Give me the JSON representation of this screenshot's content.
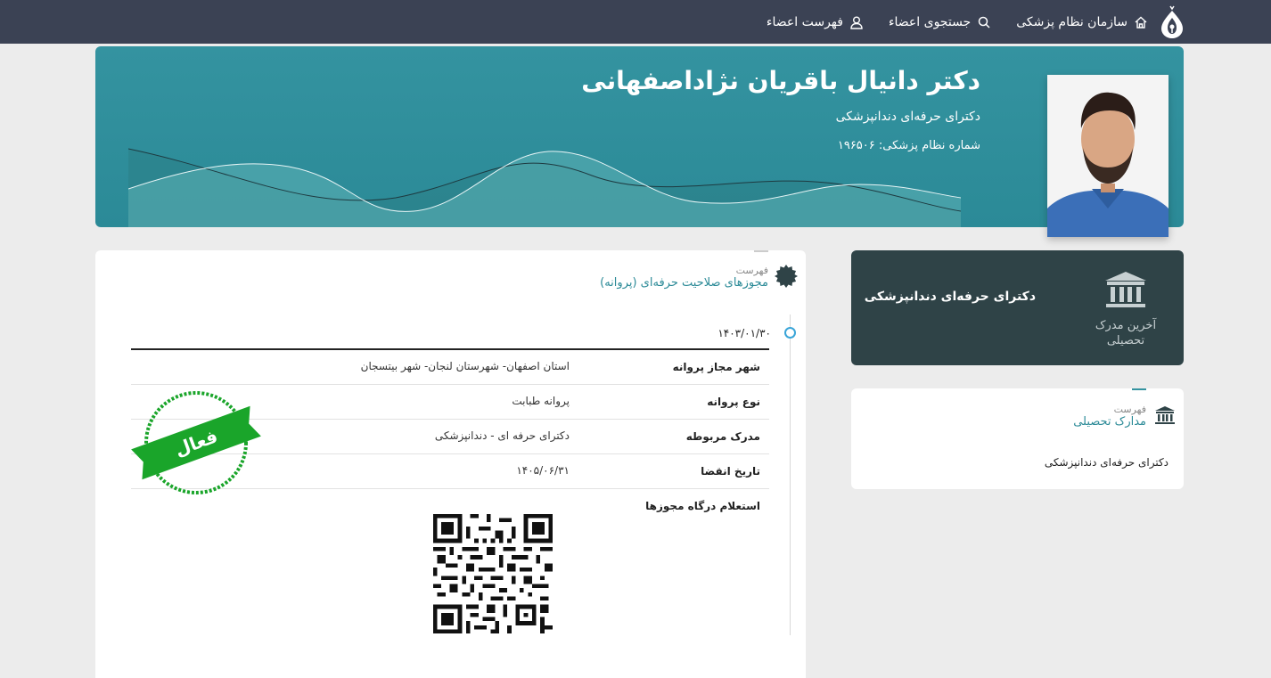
{
  "nav": {
    "home_label": "سازمان نظام پزشکی",
    "search_label": "جستجوی اعضاء",
    "members_label": "فهرست اعضاء"
  },
  "profile": {
    "name": "دکتر دانیال باقریان نژاداصفهانی",
    "title": "دکترای حرفه‌ای دندانپزشکی",
    "number_text": "شماره نظام پزشکی: ۱۹۶۵۰۶"
  },
  "education_card": {
    "label": "آخرین مدرک تحصیلی",
    "value": "دکترای حرفه‌ای دندانپزشکی"
  },
  "documents_card": {
    "caption": "فهرست",
    "heading": "مدارک تحصیلی",
    "items": [
      "دکترای حرفه‌ای دندانپزشکی"
    ]
  },
  "licenses_card": {
    "caption": "فهرست",
    "heading": "مجوزهای صلاحیت حرفه‌ای (پروانه)",
    "date": "۱۴۰۳/۰۱/۳۰",
    "rows": [
      {
        "key": "شهر مجاز پروانه",
        "value": "استان اصفهان- شهرستان لنجان- شهر بیتسجان"
      },
      {
        "key": "نوع پروانه",
        "value": "پروانه طبابت"
      },
      {
        "key": "مدرک مربوطه",
        "value": "دکترای حرفه ای - دندانپزشکی"
      },
      {
        "key": "تاریخ انقضا",
        "value": "۱۴۰۵/۰۶/۳۱"
      },
      {
        "key": "استعلام درگاه مجوزها",
        "value": ""
      }
    ],
    "stamp_text": "فعال"
  },
  "colors": {
    "nav_bg": "#3b4254",
    "banner": "#3493a0",
    "accent": "#2b8a97",
    "edu_card": "#2f4347",
    "stamp_green": "#1aa52a"
  }
}
